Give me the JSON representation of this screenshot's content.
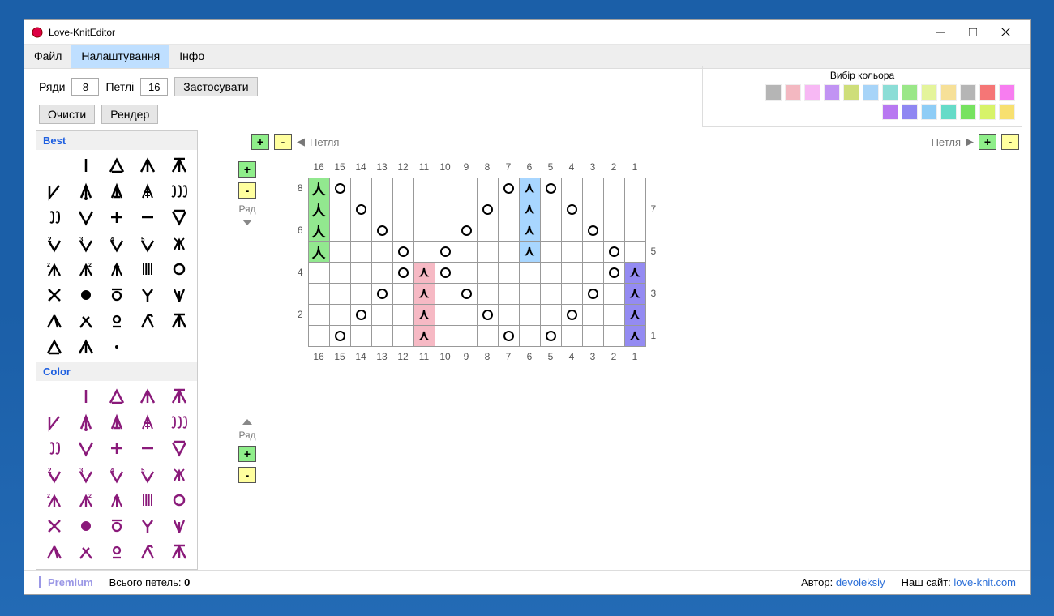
{
  "title": "Love-KnitEditor",
  "menu": {
    "file": "Файл",
    "settings": "Налаштування",
    "info": "Інфо"
  },
  "toolbar": {
    "rows_label": "Ряди",
    "rows_value": "8",
    "loops_label": "Петлі",
    "loops_value": "16",
    "apply": "Застосувати",
    "clear": "Очисти",
    "render": "Рендер"
  },
  "colorpick": {
    "title": "Вибір кольора",
    "row1": [
      "#b5b5b5",
      "#f3b8c1",
      "#f7b8f4",
      "#c193f3",
      "#cede7a",
      "#a7d4f8",
      "#8bddd6",
      "#9ae788",
      "#e4f49b",
      "#f6e098",
      "#b5b5b5",
      "#f57676",
      "#f77df0"
    ],
    "row2": [
      "#b878f1",
      "#8f87f2",
      "#8fcdf6",
      "#66dbc8",
      "#77e260",
      "#d7f36a",
      "#f7e070"
    ]
  },
  "loop": {
    "label_left": "Петля",
    "label_right": "Петля",
    "plus": "+",
    "minus": "-"
  },
  "row_label": "Ряд",
  "palette": {
    "best": "Best",
    "color": "Color"
  },
  "grid": {
    "cols": [
      16,
      15,
      14,
      13,
      12,
      11,
      10,
      9,
      8,
      7,
      6,
      5,
      4,
      3,
      2,
      1
    ],
    "left_rows": [
      8,
      6,
      4,
      2
    ],
    "right_rows": [
      7,
      5,
      3,
      1
    ]
  },
  "status": {
    "premium": "Premium",
    "total": "Всього петель:",
    "total_n": "0",
    "author_label": "Автор:",
    "author": "devoleksiy",
    "site_label": "Наш сайт:",
    "site": "love-knit.com"
  }
}
